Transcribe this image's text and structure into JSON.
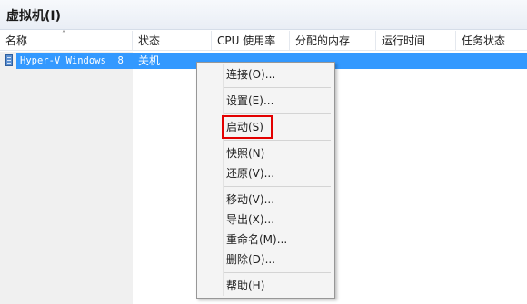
{
  "window": {
    "title": "虚拟机(I)"
  },
  "columns": {
    "name": "名称",
    "status": "状态",
    "cpu": "CPU 使用率",
    "memory": "分配的内存",
    "uptime": "运行时间",
    "task_status": "任务状态"
  },
  "vms": [
    {
      "name": "Hyper-V Windows  8",
      "status": "关机"
    }
  ],
  "context_menu": {
    "connect": "连接(O)...",
    "settings": "设置(E)...",
    "start": "启动(S)",
    "snapshot": "快照(N)",
    "revert": "还原(V)...",
    "move": "移动(V)...",
    "export": "导出(X)...",
    "rename": "重命名(M)...",
    "delete": "删除(D)...",
    "help": "帮助(H)"
  },
  "colors": {
    "selection": "#3399ff",
    "highlight_box": "#e30000"
  },
  "icons": {
    "vm": "vm-icon",
    "sort": "sort-ascending-icon"
  }
}
